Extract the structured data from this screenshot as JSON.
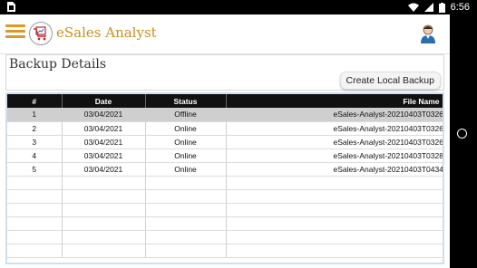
{
  "status_bar": {
    "time": "6:56",
    "notification_icon": "sim-card-icon",
    "icons": [
      "wifi-icon",
      "signal-icon",
      "battery-icon"
    ]
  },
  "header": {
    "app_title": "eSales Analyst",
    "menu_icon": "hamburger-menu-icon",
    "logo_icon": "cart-logo-icon",
    "user_icon": "user-avatar-icon",
    "accent_color": "#d99a29"
  },
  "page": {
    "title": "Backup Details",
    "create_backup_label": "Create Local Backup"
  },
  "grid": {
    "columns": [
      "#",
      "Date",
      "Status",
      "File Name"
    ],
    "sort_indicator": "+",
    "rows": [
      {
        "num": "1",
        "date": "03/04/2021",
        "status": "Offline",
        "file": "eSales-Analyst-20210403T0326",
        "selected": true
      },
      {
        "num": "2",
        "date": "03/04/2021",
        "status": "Online",
        "file": "eSales-Analyst-20210403T0326",
        "selected": false
      },
      {
        "num": "3",
        "date": "03/04/2021",
        "status": "Online",
        "file": "eSales-Analyst-20210403T0326",
        "selected": false
      },
      {
        "num": "4",
        "date": "03/04/2021",
        "status": "Online",
        "file": "eSales-Analyst-20210403T0328",
        "selected": false
      },
      {
        "num": "5",
        "date": "03/04/2021",
        "status": "Online",
        "file": "eSales-Analyst-20210403T0434",
        "selected": false
      }
    ],
    "empty_rows": 6
  }
}
